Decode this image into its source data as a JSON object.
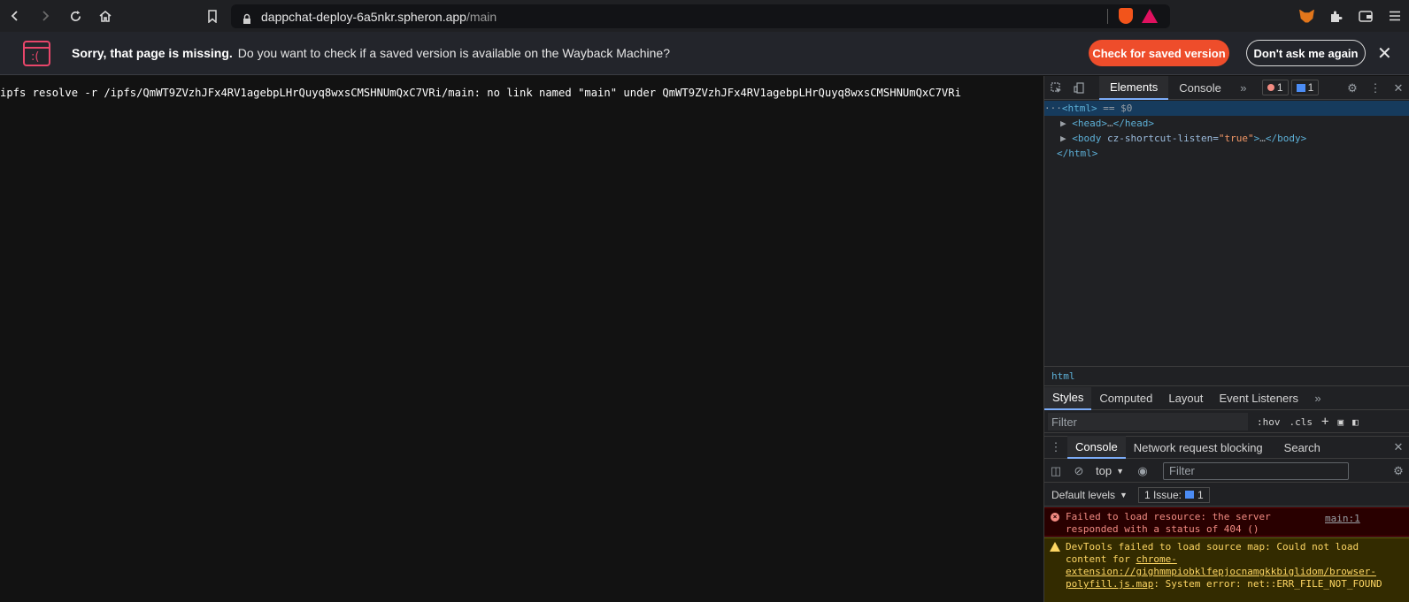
{
  "browser": {
    "url_host": "dappchat-deploy-6a5nkr.spheron.app",
    "url_path": "/main"
  },
  "infobar": {
    "title": "Sorry, that page is missing.",
    "message": "Do you want to check if a saved version is available on the Wayback Machine?",
    "check_label": "Check for saved version",
    "dont_label": "Don't ask me again"
  },
  "page": {
    "text": "ipfs resolve -r /ipfs/QmWT9ZVzhJFx4RV1agebpLHrQuyq8wxsCMSHNUmQxC7VRi/main: no link named \"main\" under QmWT9ZVzhJFx4RV1agebpLHrQuyq8wxsCMSHNUmQxC7VRi"
  },
  "devtools": {
    "tabs": [
      "Elements",
      "Console"
    ],
    "error_count": "1",
    "message_count": "1",
    "dom": {
      "html_open": "<html>",
      "selected_suffix": "== $0",
      "head": "<head>",
      "head_ellipsis": "…",
      "head_close": "</head>",
      "body_open": "<body",
      "body_attr_name": "cz-shortcut-listen=",
      "body_attr_value": "\"true\"",
      "body_gt": ">",
      "body_ellipsis": "…",
      "body_close": "</body>",
      "html_close": "</html>"
    },
    "breadcrumb": "html",
    "styles_tabs": [
      "Styles",
      "Computed",
      "Layout",
      "Event Listeners"
    ],
    "styles_filter_placeholder": "Filter",
    "hov": ":hov",
    "cls": ".cls",
    "drawer_tabs": [
      "Console",
      "Network request blocking",
      "Search"
    ],
    "console_context": "top",
    "console_filter_placeholder": "Filter",
    "levels_label": "Default levels",
    "issues_label": "1 Issue:",
    "issues_count": "1",
    "messages": {
      "error_text": "Failed to load resource: the server responded with a status of 404 ()",
      "error_link": "main:1",
      "warn_prefix": "DevTools failed to load source map: Could not load content for ",
      "warn_link": "chrome-extension://gighmmpiobklfepjocnamgkkbiglidom/browser-polyfill.js.map",
      "warn_suffix": ": System error: net::ERR_FILE_NOT_FOUND"
    }
  },
  "colors": {
    "accent_button": "#ee4d2b",
    "error_text": "#f28b82",
    "warning_text": "#fdd663",
    "devtools_tab_active": "#7cacf8"
  }
}
